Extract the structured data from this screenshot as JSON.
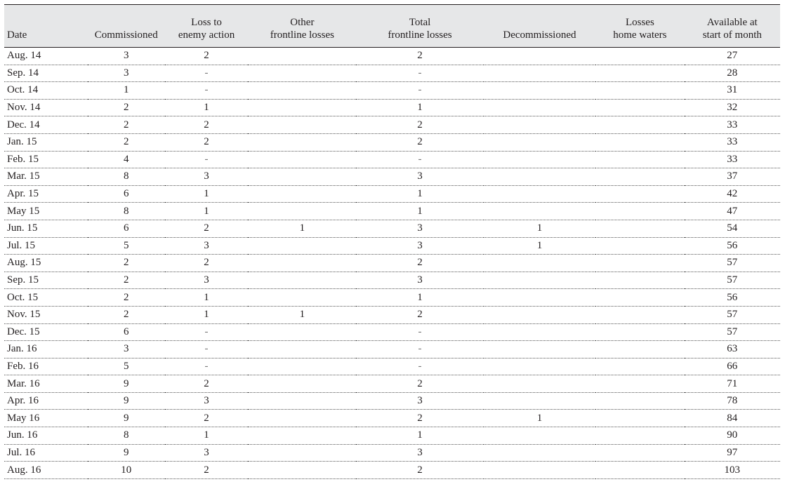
{
  "table": {
    "columns": [
      {
        "key": "date",
        "label_line1": "",
        "label_line2": "Date"
      },
      {
        "key": "commissioned",
        "label_line1": "",
        "label_line2": "Commissioned"
      },
      {
        "key": "enemy_action",
        "label_line1": "Loss to",
        "label_line2": "enemy action"
      },
      {
        "key": "other_frontline",
        "label_line1": "Other",
        "label_line2": "frontline losses"
      },
      {
        "key": "total_frontline",
        "label_line1": "Total",
        "label_line2": "frontline losses"
      },
      {
        "key": "decommissioned",
        "label_line1": "",
        "label_line2": "Decommissioned"
      },
      {
        "key": "home_waters",
        "label_line1": "Losses",
        "label_line2": "home waters"
      },
      {
        "key": "available",
        "label_line1": "Available at",
        "label_line2": "start of month"
      }
    ],
    "rows": [
      {
        "date": "Aug. 14",
        "commissioned": "3",
        "enemy_action": "2",
        "other_frontline": "",
        "total_frontline": "2",
        "decommissioned": "",
        "home_waters": "",
        "available": "27"
      },
      {
        "date": "Sep. 14",
        "commissioned": "3",
        "enemy_action": "-",
        "other_frontline": "",
        "total_frontline": "-",
        "decommissioned": "",
        "home_waters": "",
        "available": "28"
      },
      {
        "date": "Oct. 14",
        "commissioned": "1",
        "enemy_action": "-",
        "other_frontline": "",
        "total_frontline": "-",
        "decommissioned": "",
        "home_waters": "",
        "available": "31"
      },
      {
        "date": "Nov. 14",
        "commissioned": "2",
        "enemy_action": "1",
        "other_frontline": "",
        "total_frontline": "1",
        "decommissioned": "",
        "home_waters": "",
        "available": "32"
      },
      {
        "date": "Dec. 14",
        "commissioned": "2",
        "enemy_action": "2",
        "other_frontline": "",
        "total_frontline": "2",
        "decommissioned": "",
        "home_waters": "",
        "available": "33"
      },
      {
        "date": "Jan. 15",
        "commissioned": "2",
        "enemy_action": "2",
        "other_frontline": "",
        "total_frontline": "2",
        "decommissioned": "",
        "home_waters": "",
        "available": "33"
      },
      {
        "date": "Feb. 15",
        "commissioned": "4",
        "enemy_action": "-",
        "other_frontline": "",
        "total_frontline": "-",
        "decommissioned": "",
        "home_waters": "",
        "available": "33"
      },
      {
        "date": "Mar. 15",
        "commissioned": "8",
        "enemy_action": "3",
        "other_frontline": "",
        "total_frontline": "3",
        "decommissioned": "",
        "home_waters": "",
        "available": "37"
      },
      {
        "date": "Apr. 15",
        "commissioned": "6",
        "enemy_action": "1",
        "other_frontline": "",
        "total_frontline": "1",
        "decommissioned": "",
        "home_waters": "",
        "available": "42"
      },
      {
        "date": "May 15",
        "commissioned": "8",
        "enemy_action": "1",
        "other_frontline": "",
        "total_frontline": "1",
        "decommissioned": "",
        "home_waters": "",
        "available": "47"
      },
      {
        "date": "Jun. 15",
        "commissioned": "6",
        "enemy_action": "2",
        "other_frontline": "1",
        "total_frontline": "3",
        "decommissioned": "1",
        "home_waters": "",
        "available": "54"
      },
      {
        "date": "Jul. 15",
        "commissioned": "5",
        "enemy_action": "3",
        "other_frontline": "",
        "total_frontline": "3",
        "decommissioned": "1",
        "home_waters": "",
        "available": "56"
      },
      {
        "date": "Aug. 15",
        "commissioned": "2",
        "enemy_action": "2",
        "other_frontline": "",
        "total_frontline": "2",
        "decommissioned": "",
        "home_waters": "",
        "available": "57"
      },
      {
        "date": "Sep. 15",
        "commissioned": "2",
        "enemy_action": "3",
        "other_frontline": "",
        "total_frontline": "3",
        "decommissioned": "",
        "home_waters": "",
        "available": "57"
      },
      {
        "date": "Oct. 15",
        "commissioned": "2",
        "enemy_action": "1",
        "other_frontline": "",
        "total_frontline": "1",
        "decommissioned": "",
        "home_waters": "",
        "available": "56"
      },
      {
        "date": "Nov. 15",
        "commissioned": "2",
        "enemy_action": "1",
        "other_frontline": "1",
        "total_frontline": "2",
        "decommissioned": "",
        "home_waters": "",
        "available": "57"
      },
      {
        "date": "Dec. 15",
        "commissioned": "6",
        "enemy_action": "-",
        "other_frontline": "",
        "total_frontline": "-",
        "decommissioned": "",
        "home_waters": "",
        "available": "57"
      },
      {
        "date": "Jan. 16",
        "commissioned": "3",
        "enemy_action": "-",
        "other_frontline": "",
        "total_frontline": "-",
        "decommissioned": "",
        "home_waters": "",
        "available": "63"
      },
      {
        "date": "Feb. 16",
        "commissioned": "5",
        "enemy_action": "-",
        "other_frontline": "",
        "total_frontline": "-",
        "decommissioned": "",
        "home_waters": "",
        "available": "66"
      },
      {
        "date": "Mar. 16",
        "commissioned": "9",
        "enemy_action": "2",
        "other_frontline": "",
        "total_frontline": "2",
        "decommissioned": "",
        "home_waters": "",
        "available": "71"
      },
      {
        "date": "Apr. 16",
        "commissioned": "9",
        "enemy_action": "3",
        "other_frontline": "",
        "total_frontline": "3",
        "decommissioned": "",
        "home_waters": "",
        "available": "78"
      },
      {
        "date": "May 16",
        "commissioned": "9",
        "enemy_action": "2",
        "other_frontline": "",
        "total_frontline": "2",
        "decommissioned": "1",
        "home_waters": "",
        "available": "84"
      },
      {
        "date": "Jun. 16",
        "commissioned": "8",
        "enemy_action": "1",
        "other_frontline": "",
        "total_frontline": "1",
        "decommissioned": "",
        "home_waters": "",
        "available": "90"
      },
      {
        "date": "Jul. 16",
        "commissioned": "9",
        "enemy_action": "3",
        "other_frontline": "",
        "total_frontline": "3",
        "decommissioned": "",
        "home_waters": "",
        "available": "97"
      },
      {
        "date": "Aug. 16",
        "commissioned": "10",
        "enemy_action": "2",
        "other_frontline": "",
        "total_frontline": "2",
        "decommissioned": "",
        "home_waters": "",
        "available": "103"
      }
    ]
  }
}
